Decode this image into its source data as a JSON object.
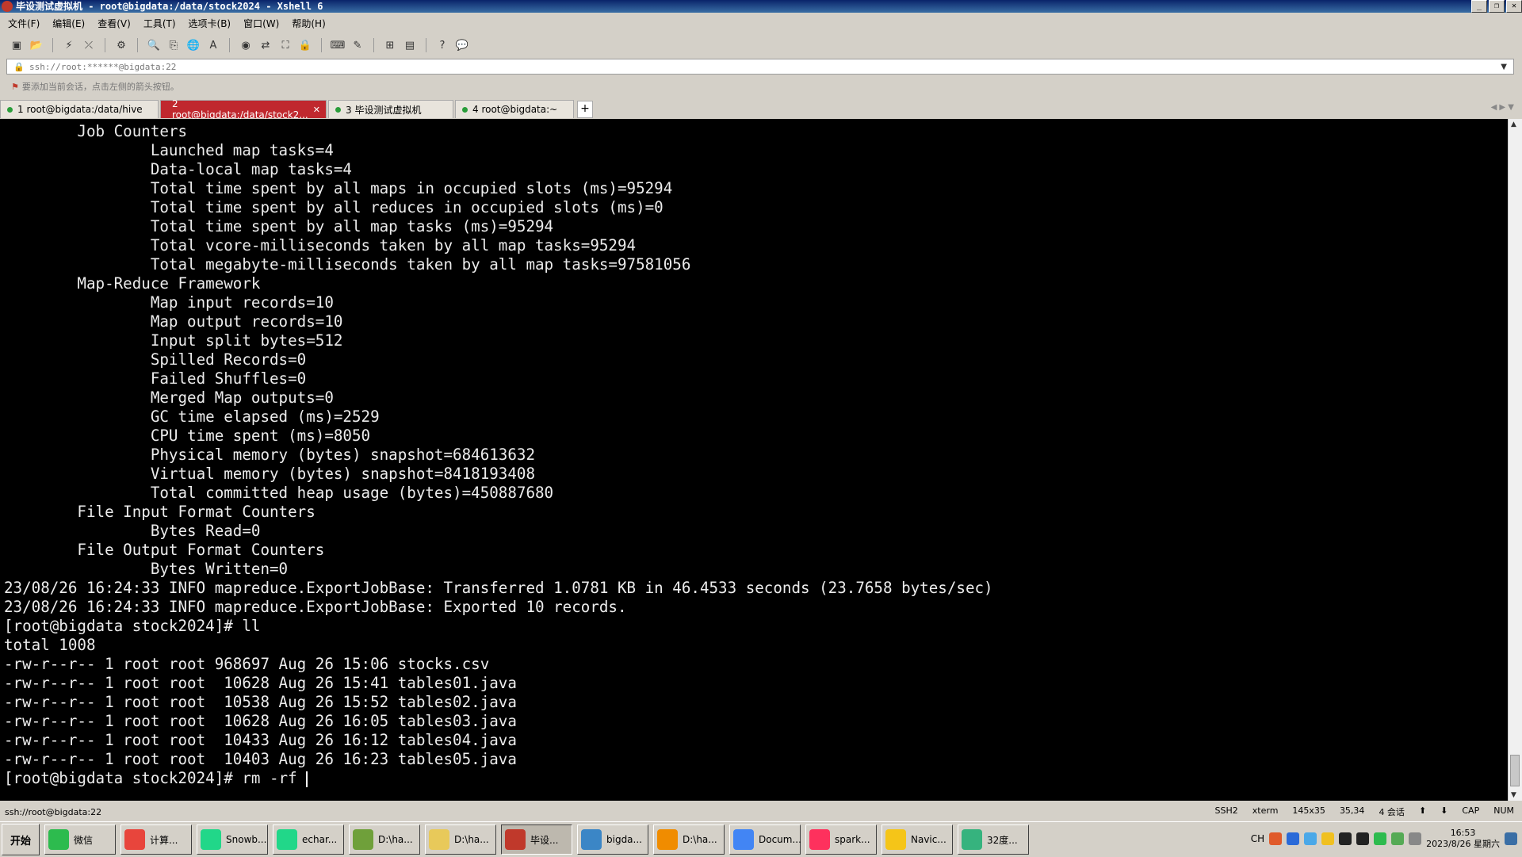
{
  "window": {
    "title": "毕设测试虚拟机 - root@bigdata:/data/stock2024 - Xshell 6"
  },
  "menu": [
    "文件(F)",
    "编辑(E)",
    "查看(V)",
    "工具(T)",
    "选项卡(B)",
    "窗口(W)",
    "帮助(H)"
  ],
  "address": {
    "value": "ssh://root:******@bigdata:22"
  },
  "hint": {
    "text": "要添加当前会话，点击左侧的箭头按钮。"
  },
  "tabs": [
    {
      "label": "1 root@bigdata:/data/hive",
      "active": false
    },
    {
      "label": "2 root@bigdata:/data/stock2...",
      "active": true
    },
    {
      "label": "3 毕设测试虚拟机",
      "active": false
    },
    {
      "label": "4 root@bigdata:~",
      "active": false
    }
  ],
  "terminal": {
    "lines": [
      "        Job Counters ",
      "                Launched map tasks=4",
      "                Data-local map tasks=4",
      "                Total time spent by all maps in occupied slots (ms)=95294",
      "                Total time spent by all reduces in occupied slots (ms)=0",
      "                Total time spent by all map tasks (ms)=95294",
      "                Total vcore-milliseconds taken by all map tasks=95294",
      "                Total megabyte-milliseconds taken by all map tasks=97581056",
      "        Map-Reduce Framework",
      "                Map input records=10",
      "                Map output records=10",
      "                Input split bytes=512",
      "                Spilled Records=0",
      "                Failed Shuffles=0",
      "                Merged Map outputs=0",
      "                GC time elapsed (ms)=2529",
      "                CPU time spent (ms)=8050",
      "                Physical memory (bytes) snapshot=684613632",
      "                Virtual memory (bytes) snapshot=8418193408",
      "                Total committed heap usage (bytes)=450887680",
      "        File Input Format Counters ",
      "                Bytes Read=0",
      "        File Output Format Counters ",
      "                Bytes Written=0",
      "23/08/26 16:24:33 INFO mapreduce.ExportJobBase: Transferred 1.0781 KB in 46.4533 seconds (23.7658 bytes/sec)",
      "23/08/26 16:24:33 INFO mapreduce.ExportJobBase: Exported 10 records.",
      "[root@bigdata stock2024]# ll",
      "total 1008",
      "-rw-r--r-- 1 root root 968697 Aug 26 15:06 stocks.csv",
      "-rw-r--r-- 1 root root  10628 Aug 26 15:41 tables01.java",
      "-rw-r--r-- 1 root root  10538 Aug 26 15:52 tables02.java",
      "-rw-r--r-- 1 root root  10628 Aug 26 16:05 tables03.java",
      "-rw-r--r-- 1 root root  10433 Aug 26 16:12 tables04.java",
      "-rw-r--r-- 1 root root  10403 Aug 26 16:23 tables05.java"
    ],
    "prompt": "[root@bigdata stock2024]# rm -rf "
  },
  "status": {
    "left": "ssh://root@bigdata:22",
    "protocol": "SSH2",
    "term": "xterm",
    "size": "145x35",
    "cursor": "35,34",
    "sessions": "4 会话",
    "cap": "CAP",
    "num": "NUM"
  },
  "taskbar": {
    "start": "开始",
    "items": [
      {
        "label": "微信",
        "color": "#2dbb4e",
        "active": false
      },
      {
        "label": "计算...",
        "color": "#e8453c",
        "active": false
      },
      {
        "label": "Snowb...",
        "color": "#21d789",
        "active": false
      },
      {
        "label": "echar...",
        "color": "#21d789",
        "active": false
      },
      {
        "label": "D:\\ha...",
        "color": "#6fa03a",
        "active": false
      },
      {
        "label": "D:\\ha...",
        "color": "#e8c95a",
        "active": false
      },
      {
        "label": "毕设...",
        "color": "#c0392b",
        "active": true
      },
      {
        "label": "bigda...",
        "color": "#3b86c6",
        "active": false
      },
      {
        "label": "D:\\ha...",
        "color": "#f08c00",
        "active": false
      },
      {
        "label": "Docum...",
        "color": "#4285f4",
        "active": false
      },
      {
        "label": "spark...",
        "color": "#fe315d",
        "active": false
      },
      {
        "label": "Navic...",
        "color": "#f5c518",
        "active": false
      },
      {
        "label": "32度...",
        "color": "#36b37e",
        "active": false
      }
    ],
    "clock_time": "16:53",
    "clock_date": "2023/8/26 星期六",
    "ime": "CH"
  }
}
